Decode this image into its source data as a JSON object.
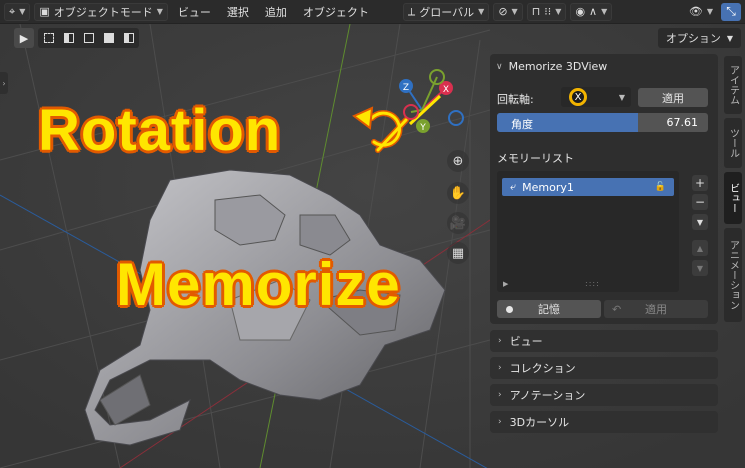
{
  "header": {
    "mode_label": "オブジェクトモード",
    "menus": [
      "ビュー",
      "選択",
      "追加",
      "オブジェクト"
    ],
    "orientation_label": "グローバル",
    "icons": [
      "editor-type-icon",
      "transform-orientation-icon",
      "pivot-icon",
      "snap-icon",
      "proportional-icon",
      "overlay-icon",
      "gizmo-icon"
    ]
  },
  "toolbar": {
    "options_label": "オプション"
  },
  "overlay": {
    "rotation_text": "Rotation",
    "memorize_text": "Memorize"
  },
  "gizmo": {
    "z": "Z",
    "x": "X",
    "y": "Y"
  },
  "sidebar": {
    "panel_title": "Memorize 3DView",
    "rotation_axis_label": "回転軸:",
    "rotation_axis_value": "X",
    "apply_label": "適用",
    "angle_label": "角度",
    "angle_value": "67.61",
    "angle_fraction": 0.67,
    "memory_list_title": "メモリーリスト",
    "memory_items": [
      {
        "name": "Memory1"
      }
    ],
    "memorize_button": "記憶",
    "apply_bottom": "適用",
    "sub_panels": [
      "ビュー",
      "コレクション",
      "アノテーション",
      "3Dカーソル"
    ]
  },
  "tabs": [
    {
      "label": "アイテム",
      "active": false
    },
    {
      "label": "ツール",
      "active": false
    },
    {
      "label": "ビュー",
      "active": true
    },
    {
      "label": "アニメーション",
      "active": false
    }
  ],
  "colors": {
    "accent": "#4772b3",
    "highlight": "#ffe600",
    "outline": "#e25a00",
    "axis_x": "#d9304f",
    "axis_y": "#7aa12e",
    "axis_z": "#2f70c2"
  }
}
